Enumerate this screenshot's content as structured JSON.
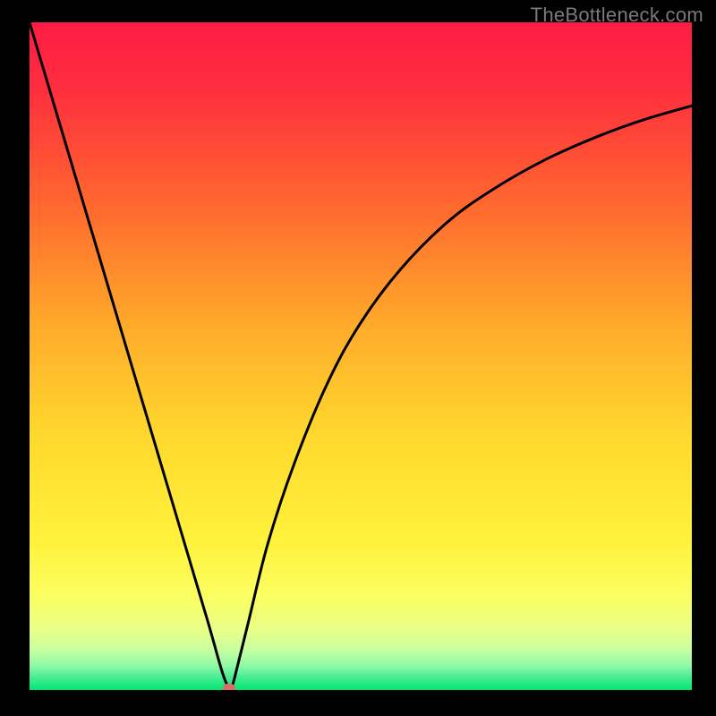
{
  "watermark_text": "TheBottleneck.com",
  "colors": {
    "background": "#000000",
    "watermark": "#7a7a7a",
    "curve": "#000000",
    "marker": "#d66e65",
    "gradient_top": "#ff1c44",
    "gradient_mid_upper": "#ff8a2a",
    "gradient_mid": "#ffd92d",
    "gradient_mid_lower": "#fff56a",
    "gradient_lower": "#ceff8e",
    "gradient_bottom": "#00e676"
  },
  "chart_data": {
    "type": "line",
    "title": "",
    "xlabel": "",
    "ylabel": "",
    "xlim": [
      0,
      100
    ],
    "ylim": [
      0,
      100
    ],
    "series": [
      {
        "name": "bottleneck-curve",
        "x": [
          0,
          3,
          6,
          9,
          12,
          15,
          18,
          21,
          24,
          27,
          29,
          30,
          30.5,
          31,
          33,
          36,
          40,
          45,
          50,
          56,
          63,
          70,
          78,
          86,
          93,
          100
        ],
        "y": [
          100,
          90,
          80,
          70,
          60,
          50,
          40,
          30,
          20,
          10,
          3,
          0.5,
          0.5,
          2,
          10,
          22,
          34,
          46,
          55,
          63,
          70,
          75,
          79.5,
          83,
          85.5,
          87.5
        ]
      }
    ],
    "marker": {
      "x": 30.2,
      "y": 0.3
    }
  }
}
